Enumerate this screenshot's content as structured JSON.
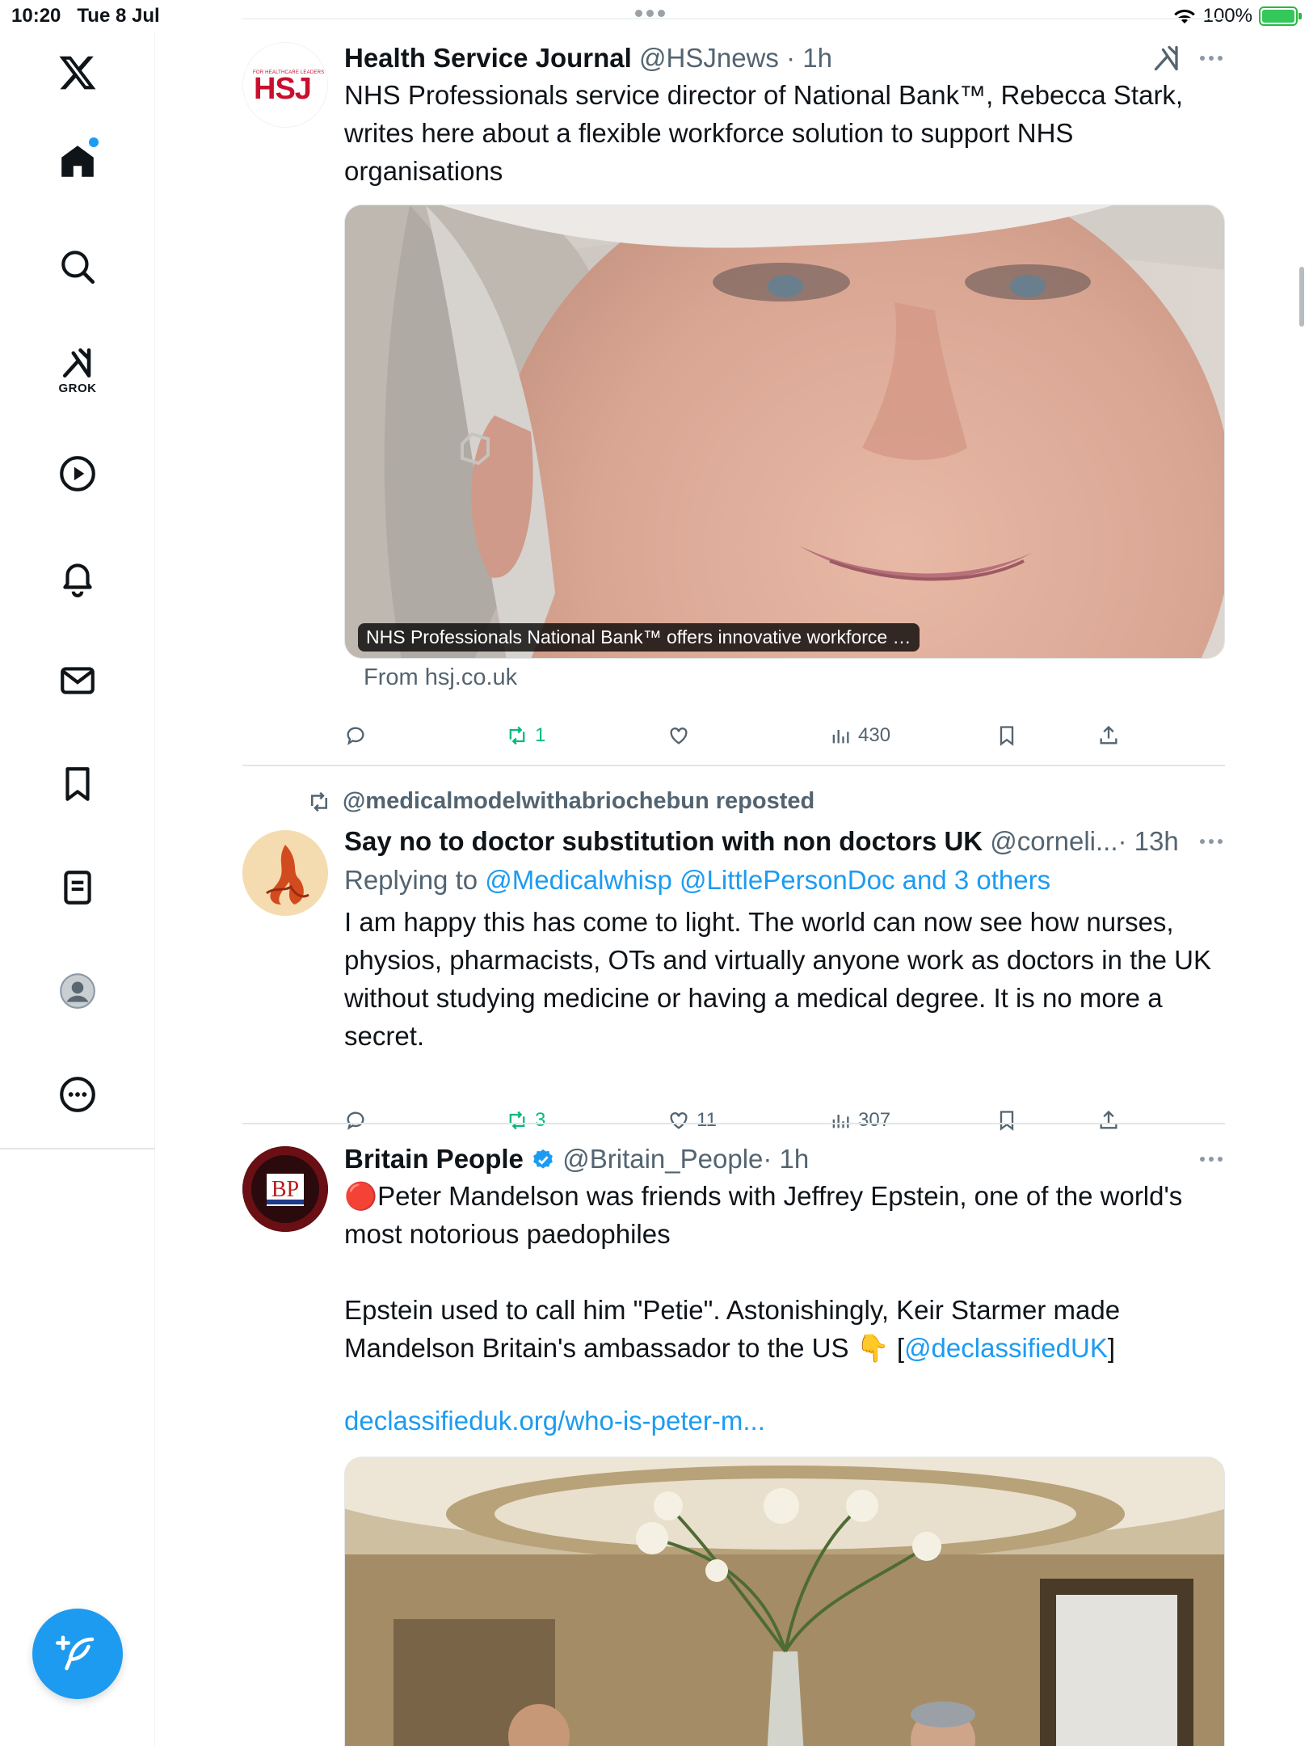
{
  "status_bar": {
    "time": "10:20",
    "date": "Tue 8 Jul",
    "battery": "100%"
  },
  "sidebar": {
    "grok_label": "GROK"
  },
  "posts": [
    {
      "name": "Health Service Journal",
      "handle": "@HSJnews",
      "time": "· 1h",
      "avatar_text": "HSJ",
      "avatar_subtext": "FOR HEALTHCARE LEADERS",
      "text": "NHS Professionals service director of National Bank™, Rebecca Stark, writes here about a flexible workforce solution to support NHS organisations",
      "media_caption": "NHS Professionals National Bank™ offers innovative workforce …",
      "from": "From hsj.co.uk",
      "replies": "",
      "reposts": "1",
      "likes": "",
      "views": "430"
    },
    {
      "repost_by": "@medicalmodelwithabriochebun reposted",
      "name": "Say no to doctor substitution with non doctors UK",
      "handle": "@corneli...",
      "time": "· 13h",
      "replying_prefix": "Replying to ",
      "replying_to": "@Medicalwhisp @LittlePersonDoc and 3 others",
      "text": "I am happy this has come to light. The world can now see how nurses, physios, pharmacists, OTs and virtually anyone work as doctors  in the UK without studying medicine or having a medical degree. It is no more a secret.",
      "replies": "",
      "reposts": "3",
      "likes": "11",
      "views": "307"
    },
    {
      "name": "Britain People",
      "handle": "@Britain_People",
      "time": "· 1h",
      "avatar_text": "BP",
      "text_line1": "🔴Peter Mandelson was friends with Jeffrey Epstein, one of the world's most notorious paedophiles",
      "text_line2_a": "Epstein used to call him \"Petie\".  Astonishingly, Keir Starmer made Mandelson Britain's ambassador to the US 👇 [",
      "text_line2_mention": "@declassifiedUK",
      "text_line2_b": "]",
      "link": "declassifieduk.org/who-is-peter-m..."
    }
  ],
  "colors": {
    "accent": "#1d9bf0",
    "repost_green": "#00ba7c",
    "secondary_text": "#536471"
  }
}
